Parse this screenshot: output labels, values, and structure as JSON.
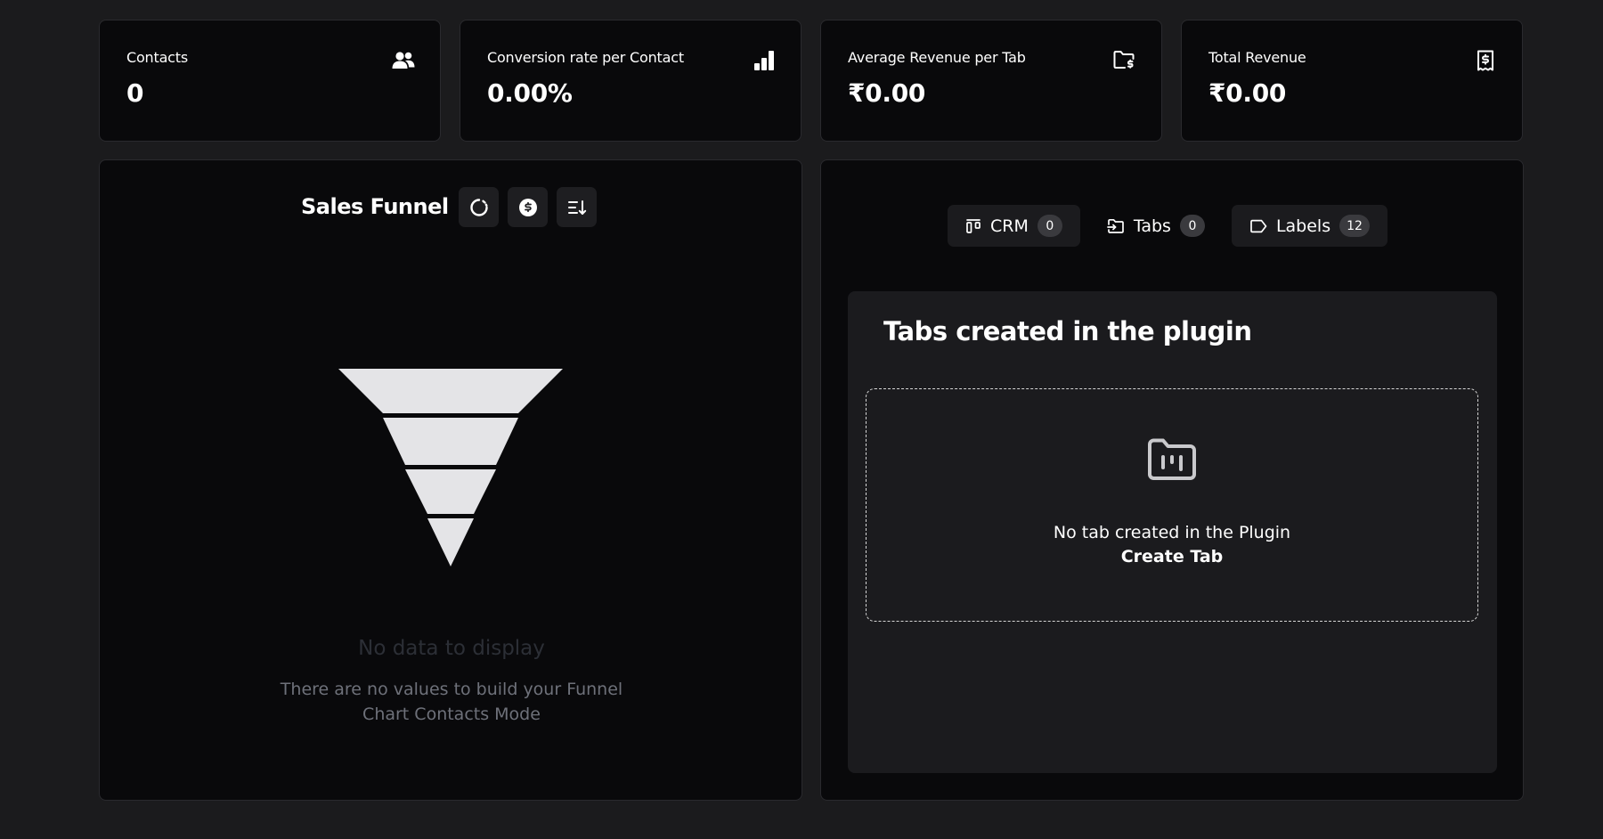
{
  "stats": [
    {
      "label": "Contacts",
      "value": "0",
      "icon": "users-icon"
    },
    {
      "label": "Conversion rate per Contact",
      "value": "0.00%",
      "icon": "bar-chart-icon"
    },
    {
      "label": "Average Revenue per Tab",
      "value": "₹0.00",
      "icon": "folder-dollar-icon"
    },
    {
      "label": "Total Revenue",
      "value": "₹0.00",
      "icon": "receipt-dollar-icon"
    }
  ],
  "funnel": {
    "title": "Sales Funnel",
    "tools": [
      "refresh-icon",
      "dollar-circle-icon",
      "sort-icon"
    ],
    "empty_title": "No data to display",
    "empty_line1": "There are no values to build your Funnel",
    "empty_line2": "Chart Contacts Mode"
  },
  "tabs": [
    {
      "label": "CRM",
      "count": "0",
      "icon": "kanban-icon",
      "active": true
    },
    {
      "label": "Tabs",
      "count": "0",
      "icon": "folder-input-icon",
      "active": false
    },
    {
      "label": "Labels",
      "count": "12",
      "icon": "tag-icon",
      "active": true
    }
  ],
  "tabs_panel": {
    "title": "Tabs created in the plugin",
    "empty_text": "No tab created in the Plugin",
    "create_link": "Create Tab"
  },
  "colors": {
    "background": "#1b1b1d",
    "card": "#09090b",
    "accent_text": "#ffffff",
    "muted_text": "#6e717a"
  }
}
